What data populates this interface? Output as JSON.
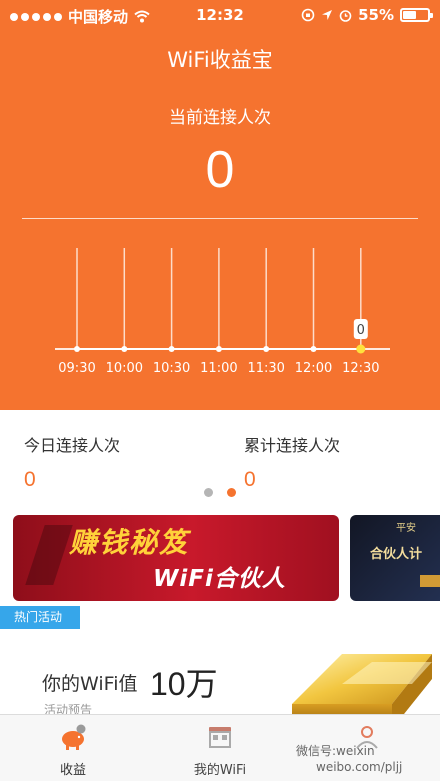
{
  "status_bar": {
    "carrier": "中国移动",
    "time": "12:32",
    "battery": "55%",
    "battery_level": 0.55
  },
  "header": {
    "title": "WiFi收益宝",
    "current_label": "当前连接人次",
    "current_value": "0"
  },
  "chart_data": {
    "type": "line",
    "x": [
      "09:30",
      "10:00",
      "10:30",
      "11:00",
      "11:30",
      "12:00",
      "12:30"
    ],
    "series": [
      {
        "values": [
          0,
          0,
          0,
          0,
          0,
          0,
          0
        ]
      }
    ],
    "highlight_label": "0"
  },
  "stats": {
    "today_label": "今日连接人次",
    "today_value": "0",
    "total_label": "累计连接人次",
    "total_value": "0"
  },
  "banners": {
    "primary_title": "赚钱秘笈",
    "primary_subtitle": "WiFi合伙人",
    "secondary_top": "平安",
    "secondary_main": "合伙人计"
  },
  "hot": {
    "tag": "热门活动",
    "promo_label": "你的WiFi值",
    "promo_value": "10万",
    "promo_sub": "活动预告"
  },
  "tabs": [
    {
      "label": "收益",
      "icon": "piggy-bank-icon",
      "active": true
    },
    {
      "label": "我的WiFi",
      "icon": "shop-icon",
      "active": false
    },
    {
      "label": "",
      "icon": "profile-icon",
      "active": false
    }
  ],
  "watermark": {
    "line1": "微信号:weixin",
    "line2": "weibo.com/pljj"
  },
  "colors": {
    "accent": "#f5732f",
    "tag_blue": "#36a6ea"
  }
}
